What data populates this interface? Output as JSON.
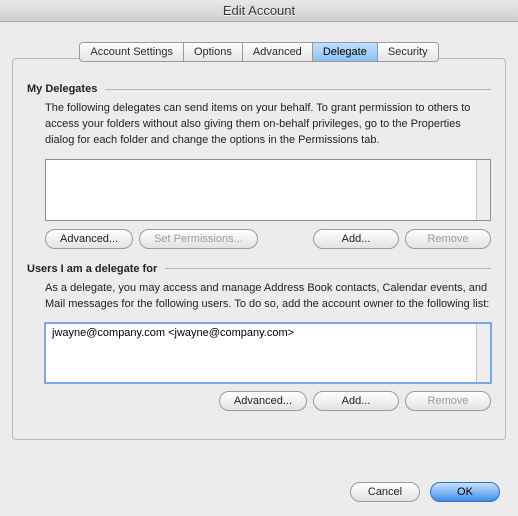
{
  "title": "Edit Account",
  "tabs": {
    "account": "Account Settings",
    "options": "Options",
    "advanced": "Advanced",
    "delegate": "Delegate",
    "security": "Security"
  },
  "delegates": {
    "heading": "My Delegates",
    "desc": "The following delegates can send items on your behalf. To grant permission to others to access your folders without also giving them on-behalf privileges, go to the Properties dialog for each folder and change the options in the Permissions tab.",
    "buttons": {
      "advanced": "Advanced...",
      "setperm": "Set Permissions...",
      "add": "Add...",
      "remove": "Remove"
    }
  },
  "users": {
    "heading": "Users I am a delegate for",
    "desc": "As a delegate, you may access and manage Address Book contacts, Calendar events, and Mail messages for the following users. To do so, add the account owner to the following list:",
    "items": [
      "jwayne@company.com <jwayne@company.com>"
    ],
    "buttons": {
      "advanced": "Advanced...",
      "add": "Add...",
      "remove": "Remove"
    }
  },
  "footer": {
    "cancel": "Cancel",
    "ok": "OK"
  }
}
